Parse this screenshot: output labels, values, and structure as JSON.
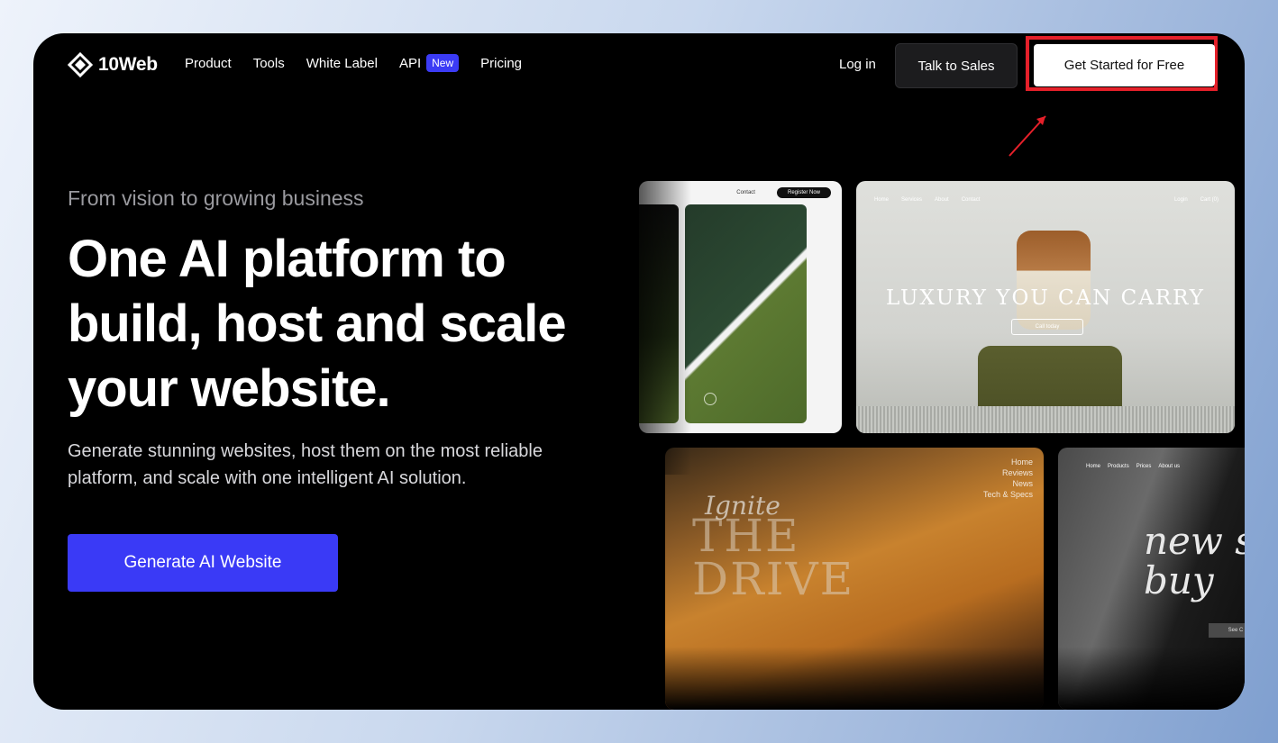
{
  "brand": {
    "name": "10Web"
  },
  "nav": {
    "items": [
      {
        "label": "Product"
      },
      {
        "label": "Tools"
      },
      {
        "label": "White Label"
      },
      {
        "label": "API",
        "badge": "New"
      },
      {
        "label": "Pricing"
      }
    ],
    "login": "Log in",
    "talk_to_sales": "Talk to Sales",
    "get_started": "Get Started for Free"
  },
  "hero": {
    "subtitle": "From vision to growing business",
    "title": "One AI platform to build, host and scale your website.",
    "description": "Generate stunning websites, host them on the most reliable platform, and scale with one intelligent AI solution.",
    "cta": "Generate AI Website"
  },
  "showcase": {
    "card1": {
      "nav_item": "Contact",
      "register": "Register Now"
    },
    "card2": {
      "nav": [
        "Home",
        "Services",
        "About",
        "Contact"
      ],
      "nav_right": [
        "Login",
        "Cart (0)"
      ],
      "headline": "LUXURY YOU CAN CARRY",
      "button": "Call today"
    },
    "card3": {
      "menu": [
        "Home",
        "Reviews",
        "News",
        "Tech & Specs"
      ],
      "script": "Ignite",
      "headline": "THE DRIVE"
    },
    "card4": {
      "menu": [
        "Home",
        "Products",
        "Prices",
        "About us"
      ],
      "headline": "new s buy",
      "button": "See C"
    }
  },
  "colors": {
    "accent": "#3a3af6",
    "highlight": "#e5202a",
    "badge": "#3b3bf5"
  }
}
